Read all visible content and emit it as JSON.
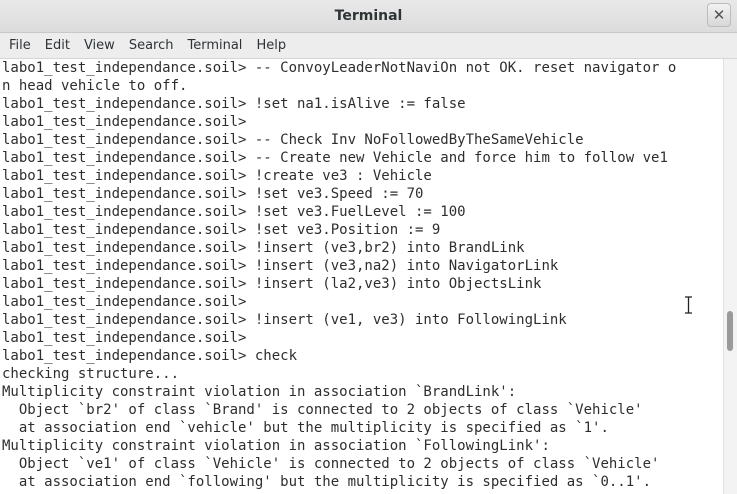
{
  "window": {
    "title": "Terminal",
    "close_glyph": "✕"
  },
  "menu": [
    "File",
    "Edit",
    "View",
    "Search",
    "Terminal",
    "Help"
  ],
  "terminal": {
    "lines": [
      "labo1_test_independance.soil> -- ConvoyLeaderNotNaviOn not OK. reset navigator o",
      "n head vehicle to off.",
      "labo1_test_independance.soil> !set na1.isAlive := false",
      "labo1_test_independance.soil>",
      "labo1_test_independance.soil> -- Check Inv NoFollowedByTheSameVehicle",
      "labo1_test_independance.soil> -- Create new Vehicle and force him to follow ve1",
      "labo1_test_independance.soil> !create ve3 : Vehicle",
      "labo1_test_independance.soil> !set ve3.Speed := 70",
      "labo1_test_independance.soil> !set ve3.FuelLevel := 100",
      "labo1_test_independance.soil> !set ve3.Position := 9",
      "labo1_test_independance.soil> !insert (ve3,br2) into BrandLink",
      "labo1_test_independance.soil> !insert (ve3,na2) into NavigatorLink",
      "labo1_test_independance.soil> !insert (la2,ve3) into ObjectsLink",
      "labo1_test_independance.soil>",
      "labo1_test_independance.soil> !insert (ve1, ve3) into FollowingLink",
      "labo1_test_independance.soil>",
      "labo1_test_independance.soil> check",
      "checking structure...",
      "Multiplicity constraint violation in association `BrandLink':",
      "  Object `br2' of class `Brand' is connected to 2 objects of class `Vehicle'",
      "  at association end `vehicle' but the multiplicity is specified as `1'.",
      "Multiplicity constraint violation in association `FollowingLink':",
      "  Object `ve1' of class `Vehicle' is connected to 2 objects of class `Vehicle'",
      "  at association end `following' but the multiplicity is specified as `0..1'."
    ]
  }
}
